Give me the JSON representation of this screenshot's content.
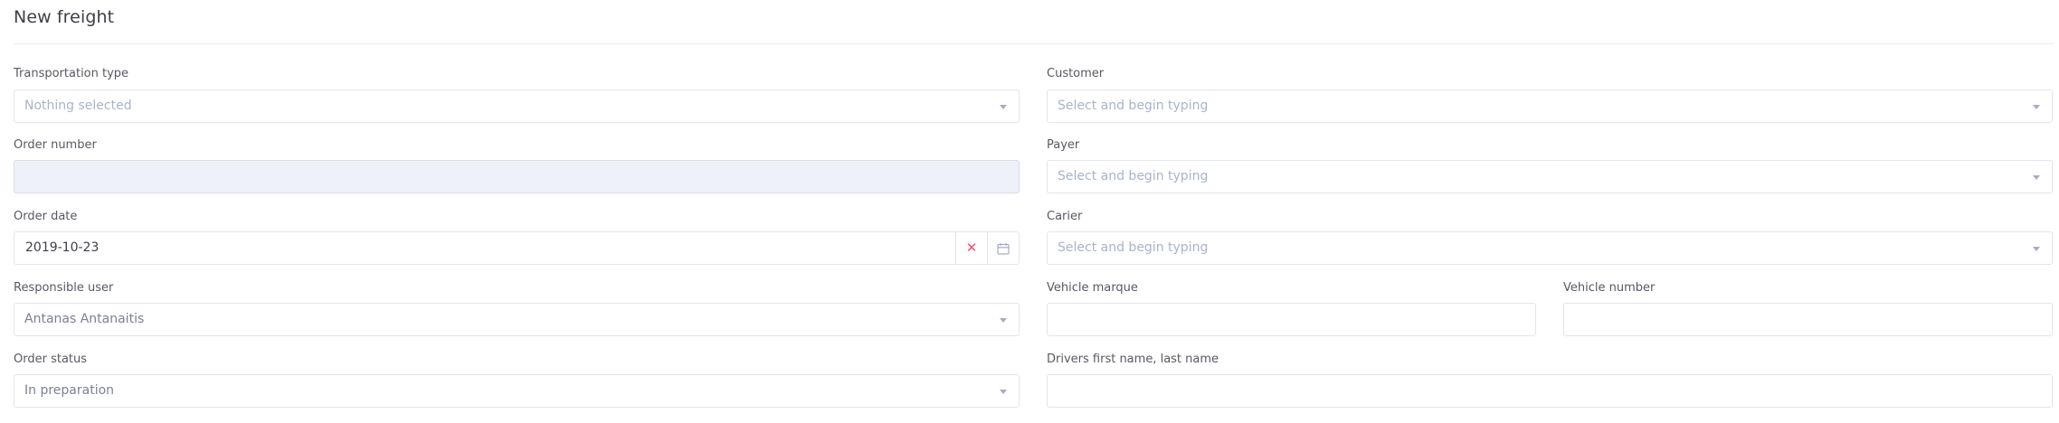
{
  "page": {
    "title": "New freight"
  },
  "form": {
    "transportation_type": {
      "label": "Transportation type",
      "value": "Nothing selected"
    },
    "customer": {
      "label": "Customer",
      "placeholder": "Select and begin typing"
    },
    "order_number": {
      "label": "Order number",
      "value": ""
    },
    "payer": {
      "label": "Payer",
      "placeholder": "Select and begin typing"
    },
    "order_date": {
      "label": "Order date",
      "value": "2019-10-23",
      "clear_icon": "close-icon",
      "calendar_icon": "calendar-icon"
    },
    "carier": {
      "label": "Carier",
      "placeholder": "Select and begin typing"
    },
    "responsible_user": {
      "label": "Responsible user",
      "value": "Antanas Antanaitis"
    },
    "vehicle_marque": {
      "label": "Vehicle marque",
      "value": ""
    },
    "vehicle_number": {
      "label": "Vehicle number",
      "value": ""
    },
    "order_status": {
      "label": "Order status",
      "value": "In preparation"
    },
    "drivers_name": {
      "label": "Drivers first name, last name",
      "value": ""
    }
  },
  "colors": {
    "clear_icon": "#f4516c",
    "placeholder": "#a9b3cc",
    "border": "#e2e5ec",
    "disabled_bg": "#eef2f8"
  }
}
